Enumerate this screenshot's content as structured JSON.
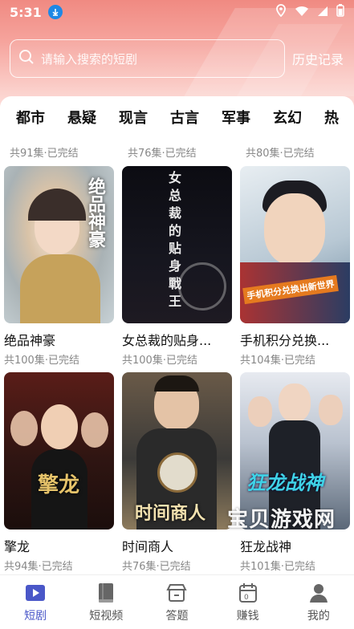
{
  "status_bar": {
    "time": "5:31"
  },
  "search": {
    "placeholder": "请输入搜索的短剧",
    "history_label": "历史记录"
  },
  "tabs": [
    "都市",
    "悬疑",
    "现言",
    "古言",
    "军事",
    "玄幻",
    "热"
  ],
  "partial_row": [
    {
      "meta": "共91集·已完结"
    },
    {
      "meta": "共76集·已完结"
    },
    {
      "meta": "共80集·已完结"
    }
  ],
  "cards": [
    {
      "title": "绝品神豪",
      "meta": "共100集·已完结",
      "poster_text": "绝品神豪"
    },
    {
      "title": "女总裁的贴身...",
      "meta": "共100集·已完结",
      "poster_text": "女总裁的贴身戰王"
    },
    {
      "title": "手机积分兑换...",
      "meta": "共104集·已完结",
      "poster_text": "手机积分兑换出新世界"
    },
    {
      "title": "擎龙",
      "meta": "共94集·已完结",
      "poster_text": "擎龙"
    },
    {
      "title": "时间商人",
      "meta": "共76集·已完结",
      "poster_text": "时间商人"
    },
    {
      "title": "狂龙战神",
      "meta": "共101集·已完结",
      "poster_text": "狂龙战神"
    }
  ],
  "bottom_row": [
    {
      "meta": "共94集·已完结"
    },
    {
      "meta": "共76集·已完结"
    },
    {
      "meta": "共101集·已完结"
    }
  ],
  "watermark": "宝贝游戏网",
  "bottom_nav": [
    {
      "label": "短剧",
      "icon": "play-icon",
      "active": true
    },
    {
      "label": "短视频",
      "icon": "book-icon",
      "active": false
    },
    {
      "label": "答题",
      "icon": "shop-icon",
      "active": false
    },
    {
      "label": "赚钱",
      "icon": "calendar-icon",
      "active": false
    },
    {
      "label": "我的",
      "icon": "person-icon",
      "active": false
    }
  ],
  "colors": {
    "accent": "#4a57c8",
    "header": "#f08a82"
  }
}
